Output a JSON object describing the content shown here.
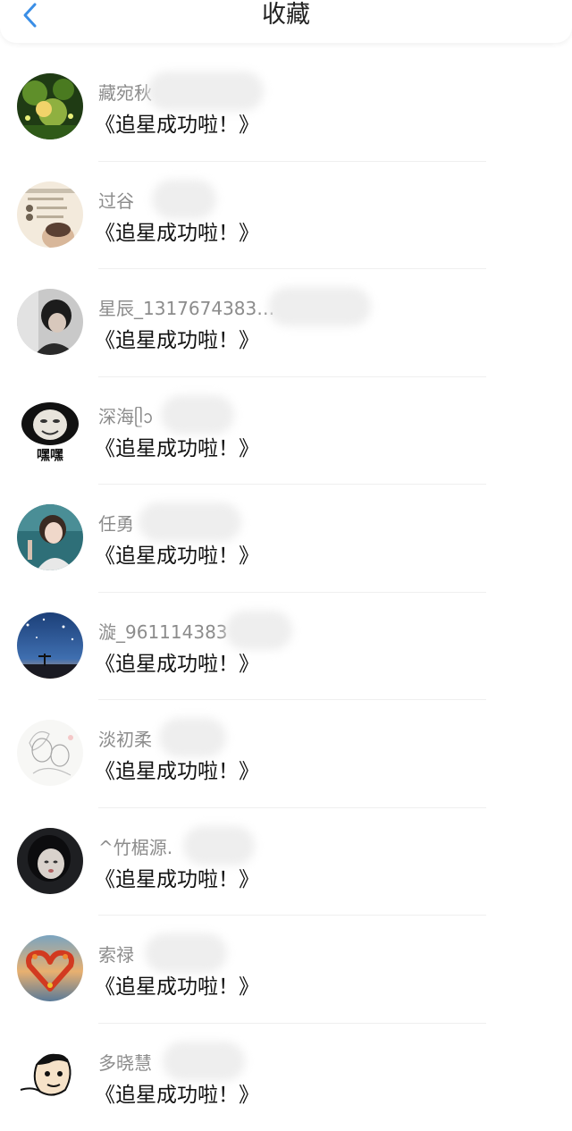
{
  "header": {
    "title": "收藏",
    "back_icon": "chevron-left-icon",
    "accent_color": "#3a8ee6"
  },
  "items": [
    {
      "name": "藏宛秋",
      "title": "《追星成功啦！》",
      "avatar": "avatar-green-forest"
    },
    {
      "name": "过谷",
      "title": "《追星成功啦！》",
      "avatar": "avatar-screenshot-boy"
    },
    {
      "name": "星辰_1317674383…",
      "title": "《追星成功啦！》",
      "avatar": "avatar-dark-hair"
    },
    {
      "name": "深海ᥫᩣ",
      "title": "《追星成功啦！》",
      "avatar": "avatar-meme-heihei"
    },
    {
      "name": "任勇",
      "title": "《追星成功啦！》",
      "avatar": "avatar-girl-selfie"
    },
    {
      "name": "漩_961114383",
      "title": "《追星成功啦！》",
      "avatar": "avatar-night-sky"
    },
    {
      "name": "淡初柔",
      "title": "《追星成功啦！》",
      "avatar": "avatar-sketch-couple"
    },
    {
      "name": "^竹椐源.",
      "title": "《追星成功啦！》",
      "avatar": "avatar-girl-dark"
    },
    {
      "name": "索禄",
      "title": "《追星成功啦！》",
      "avatar": "avatar-flower-heart"
    },
    {
      "name": "多晓慧",
      "title": "《追星成功啦！》",
      "avatar": "avatar-cartoon-face"
    }
  ],
  "avatar_meme_text": "嘿嘿"
}
